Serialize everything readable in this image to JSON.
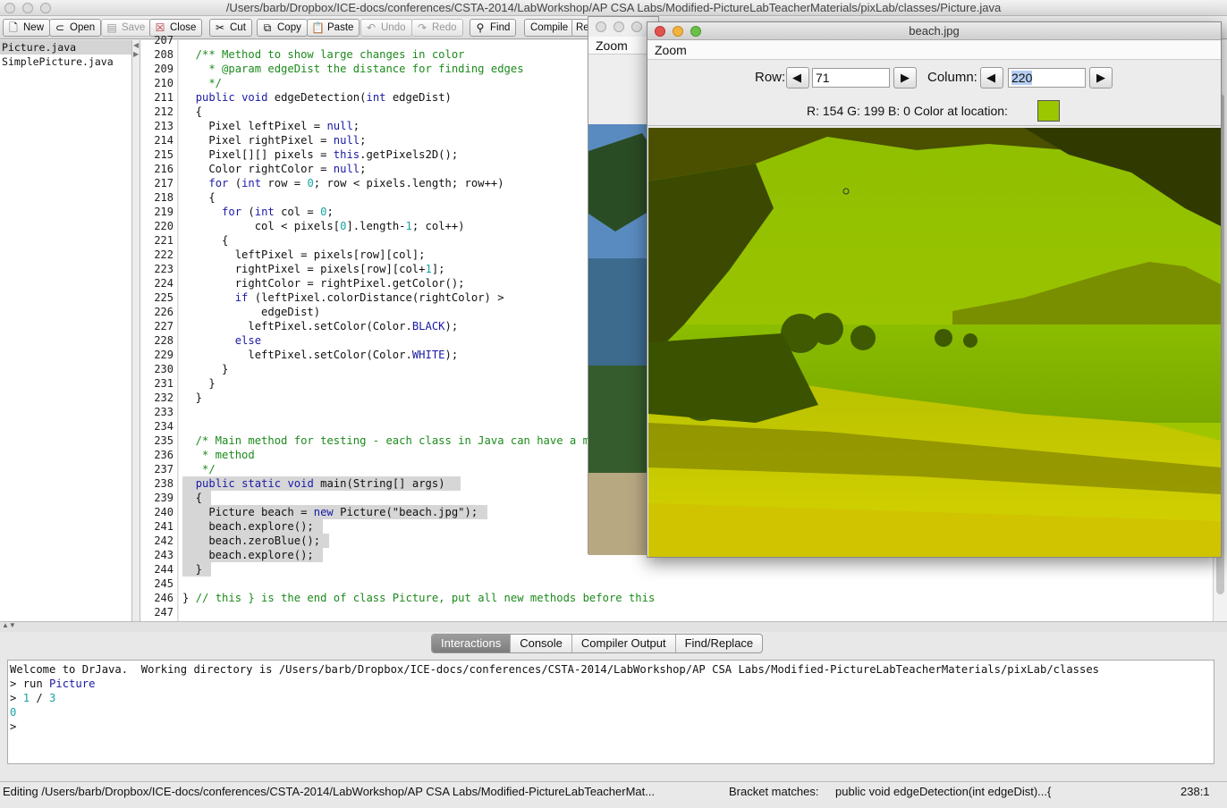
{
  "window": {
    "title": "/Users/barb/Dropbox/ICE-docs/conferences/CSTA-2014/LabWorkshop/AP CSA Labs/Modified-PictureLabTeacherMaterials/pixLab/classes/Picture.java"
  },
  "toolbar": {
    "new": "New",
    "open": "Open",
    "save": "Save",
    "close": "Close",
    "cut": "Cut",
    "copy": "Copy",
    "paste": "Paste",
    "undo": "Undo",
    "redo": "Redo",
    "find": "Find",
    "compile": "Compile",
    "reset_partial": "Re"
  },
  "files": [
    "Picture.java",
    "SimplePicture.java"
  ],
  "colors": {
    "keyword": "#1a1aa6",
    "comment": "#1c8a1c",
    "number": "#1aa3a3",
    "string": "#1a1a1a",
    "highlight": "#d6d6d6",
    "swatch": "#9ac700"
  },
  "editor": {
    "lines": [
      {
        "n": "207",
        "t": ""
      },
      {
        "n": "208",
        "t": "  /** Method to show large changes in color"
      },
      {
        "n": "209",
        "t": "    * @param edgeDist the distance for finding edges"
      },
      {
        "n": "210",
        "t": "    */"
      },
      {
        "n": "211",
        "t": "  public void edgeDetection(int edgeDist)"
      },
      {
        "n": "212",
        "t": "  {"
      },
      {
        "n": "213",
        "t": "    Pixel leftPixel = null;"
      },
      {
        "n": "214",
        "t": "    Pixel rightPixel = null;"
      },
      {
        "n": "215",
        "t": "    Pixel[][] pixels = this.getPixels2D();"
      },
      {
        "n": "216",
        "t": "    Color rightColor = null;"
      },
      {
        "n": "217",
        "t": "    for (int row = 0; row < pixels.length; row++)"
      },
      {
        "n": "218",
        "t": "    {"
      },
      {
        "n": "219",
        "t": "      for (int col = 0;"
      },
      {
        "n": "220",
        "t": "           col < pixels[0].length-1; col++)"
      },
      {
        "n": "221",
        "t": "      {"
      },
      {
        "n": "222",
        "t": "        leftPixel = pixels[row][col];"
      },
      {
        "n": "223",
        "t": "        rightPixel = pixels[row][col+1];"
      },
      {
        "n": "224",
        "t": "        rightColor = rightPixel.getColor();"
      },
      {
        "n": "225",
        "t": "        if (leftPixel.colorDistance(rightColor) >"
      },
      {
        "n": "226",
        "t": "            edgeDist)"
      },
      {
        "n": "227",
        "t": "          leftPixel.setColor(Color.BLACK);"
      },
      {
        "n": "228",
        "t": "        else"
      },
      {
        "n": "229",
        "t": "          leftPixel.setColor(Color.WHITE);"
      },
      {
        "n": "230",
        "t": "      }"
      },
      {
        "n": "231",
        "t": "    }"
      },
      {
        "n": "232",
        "t": "  }"
      },
      {
        "n": "233",
        "t": ""
      },
      {
        "n": "234",
        "t": ""
      },
      {
        "n": "235",
        "t": "  /* Main method for testing - each class in Java can have a main"
      },
      {
        "n": "236",
        "t": "   * method"
      },
      {
        "n": "237",
        "t": "   */"
      },
      {
        "n": "238",
        "t": "  public static void main(String[] args) "
      },
      {
        "n": "239",
        "t": "  {"
      },
      {
        "n": "240",
        "t": "    Picture beach = new Picture(\"beach.jpg\");"
      },
      {
        "n": "241",
        "t": "    beach.explore();"
      },
      {
        "n": "242",
        "t": "    beach.zeroBlue();"
      },
      {
        "n": "243",
        "t": "    beach.explore();"
      },
      {
        "n": "244",
        "t": "  }"
      },
      {
        "n": "245",
        "t": ""
      },
      {
        "n": "246",
        "t": "} // this } is the end of class Picture, put all new methods before this"
      },
      {
        "n": "247",
        "t": ""
      }
    ]
  },
  "tabs": [
    "Interactions",
    "Console",
    "Compiler Output",
    "Find/Replace"
  ],
  "interactions": {
    "welcome": "Welcome to DrJava.  Working directory is /Users/barb/Dropbox/ICE-docs/conferences/CSTA-2014/LabWorkshop/AP CSA Labs/Modified-PictureLabTeacherMaterials/pixLab/classes",
    "prompt1": "> ",
    "cmd_run": "run",
    "cmd_class": "Picture",
    "prompt2": "> ",
    "expr_a": "1",
    "expr_op": " / ",
    "expr_b": "3",
    "result": "0",
    "prompt3": ">"
  },
  "status": {
    "left": "Editing /Users/barb/Dropbox/ICE-docs/conferences/CSTA-2014/LabWorkshop/AP CSA Labs/Modified-PictureLabTeacherMat...",
    "bracket_label": "Bracket matches:",
    "bracket_value": "public void edgeDetection(int edgeDist)...{",
    "position": "238:1"
  },
  "zoom_back": {
    "menu": "Zoom"
  },
  "picture": {
    "title": "beach.jpg",
    "menu": "Zoom",
    "row_label": "Row:",
    "row_value": "71",
    "col_label": "Column:",
    "col_value": "220",
    "rgb": "R: 154 G: 199 B: 0 Color at location:"
  }
}
